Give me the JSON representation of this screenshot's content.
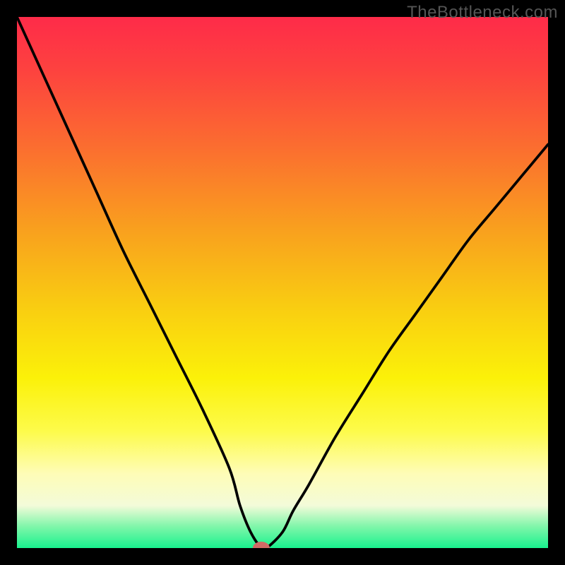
{
  "watermark": "TheBottleneck.com",
  "chart_data": {
    "type": "line",
    "title": "",
    "xlabel": "",
    "ylabel": "",
    "xlim": [
      0,
      100
    ],
    "ylim": [
      0,
      100
    ],
    "series": [
      {
        "name": "curve",
        "x": [
          0,
          5,
          10,
          15,
          20,
          25,
          30,
          35,
          40,
          42,
          44,
          46,
          47,
          50,
          52,
          55,
          60,
          65,
          70,
          75,
          80,
          85,
          90,
          95,
          100
        ],
        "values": [
          100,
          89,
          78,
          67,
          56,
          46,
          36,
          26,
          15,
          8,
          3,
          0,
          0,
          3,
          7,
          12,
          21,
          29,
          37,
          44,
          51,
          58,
          64,
          70,
          76
        ]
      }
    ],
    "marker": {
      "x": 46,
      "y": 0,
      "color": "#d06a65"
    },
    "background_gradient": [
      "#fe2b49",
      "#fb6f2f",
      "#f9ce11",
      "#fefcb7",
      "#18f28e"
    ]
  }
}
